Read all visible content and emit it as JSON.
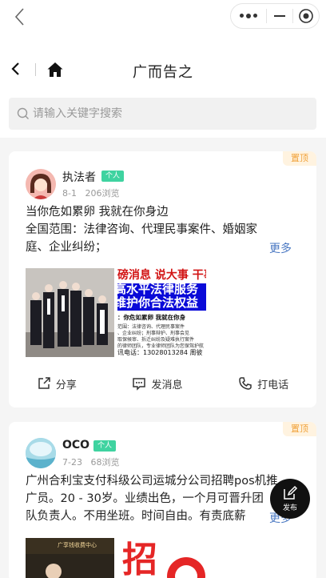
{
  "capsule": {
    "menu_icon": "more-dots-icon",
    "minimize_icon": "minimize-icon",
    "close_icon": "target-icon"
  },
  "nav": {
    "title": "广而告之",
    "back_icon": "back-arrow-icon",
    "home_icon": "home-icon"
  },
  "search": {
    "placeholder": "请输入关键字搜索",
    "icon": "search-icon"
  },
  "posts": [
    {
      "pinned_label": "置顶",
      "author": "执法者",
      "author_badge": "个人",
      "date": "8-1",
      "views": "206浏览",
      "line1": "当你危如累卵 我就在你身边",
      "line2": "全国范围：法律咨询、代理民事案件、婚姻家",
      "line3": "庭、企业纠纷；",
      "more": "更多",
      "poster": {
        "line1": "磅消息 说大事 干事",
        "line2": "高水平法律服务",
        "line3": "维护你合法权益",
        "line4": "：你危如累卵  我就在你身",
        "line5": "范围：法律咨询、代理民事案件",
        "line6": "、企业纠纷；刑事辩护、刑事会见",
        "line7": "取保候审、拆迁纠纷及疑难执行案件",
        "line8": "的律师团队，专业律师团队为您保驾护航",
        "line9": "讯电话：13028013284 周彼"
      },
      "actions": {
        "share": "分享",
        "message": "发消息",
        "call": "打电话"
      }
    },
    {
      "pinned_label": "置顶",
      "author": "OCO",
      "author_badge": "个人",
      "date": "7-23",
      "views": "68浏览",
      "line1": "广州合利宝支付科级公司运城分公司招聘pos机推",
      "line2": "广员。20 - 30岁。业绩出色，一个月可晋升团",
      "line3": "队负责人。不用坐班。时间自由。有责底薪",
      "more": "更多",
      "thumb_caption": "广享钱收费中心",
      "thumb_big": "招"
    }
  ],
  "fab": {
    "label": "发布",
    "icon": "edit-icon"
  },
  "colors": {
    "accent": "#4a78c2",
    "badge": "#3fd3a0",
    "pinned": "#f0a23a"
  }
}
